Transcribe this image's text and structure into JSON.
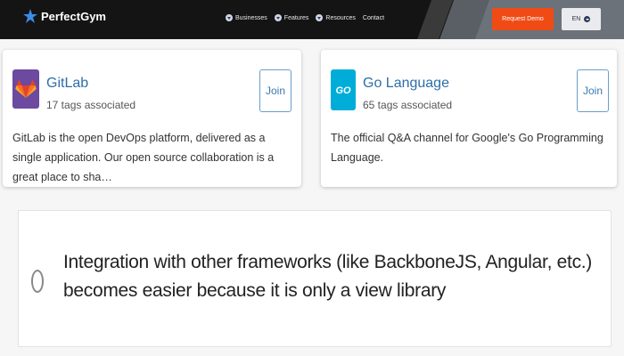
{
  "header": {
    "logo_text": "PerfectGym",
    "nav": [
      "Businesses",
      "Features",
      "Resources",
      "Contact"
    ],
    "demo_label": "Request Demo",
    "lang_label": "EN",
    "colors": {
      "background": "#141414",
      "accent": "#f04b15"
    }
  },
  "cards": [
    {
      "title": "GitLab",
      "subtitle": "17 tags associated",
      "join_label": "Join",
      "description": "GitLab is the open DevOps platform, delivered as a single application. Our open source collaboration is a great place to sha…",
      "icon": "gitlab-icon",
      "icon_color": "#6b4aa0"
    },
    {
      "title": "Go Language",
      "subtitle": "65 tags associated",
      "join_label": "Join",
      "description": "The official Q&A channel for Google's Go Programming Language.",
      "icon": "go-gopher-icon",
      "icon_color": "#00add8"
    }
  ],
  "option": {
    "text": "Integration with other frameworks (like BackboneJS, Angular, etc.) becomes easier because it is only a view library",
    "selected": false
  }
}
